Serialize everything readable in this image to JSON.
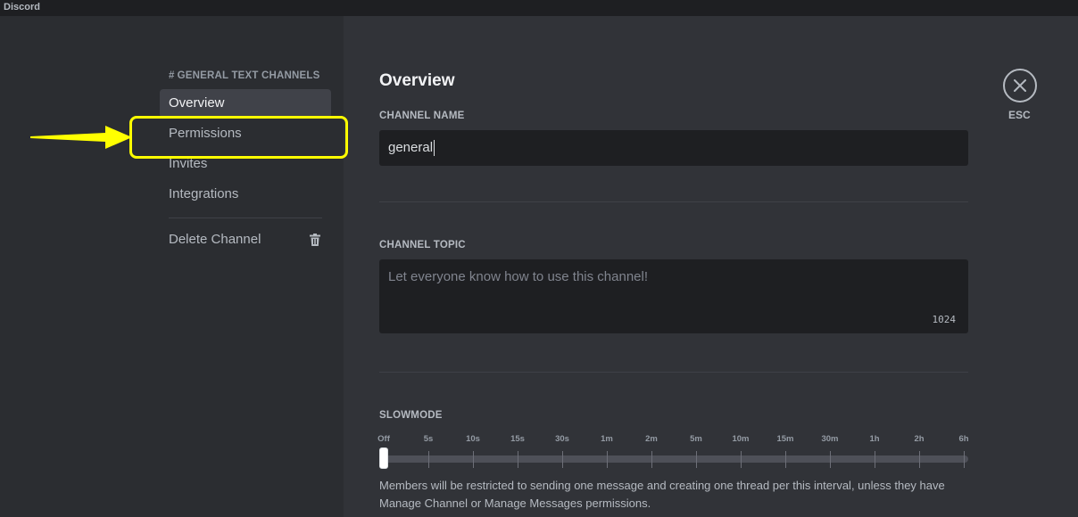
{
  "window": {
    "title": "Discord"
  },
  "sidebar": {
    "header_hash": "#",
    "header_channel": "GENERAL",
    "header_suffix": "TEXT CHANNELS",
    "items": [
      {
        "label": "Overview",
        "selected": true
      },
      {
        "label": "Permissions",
        "selected": false
      },
      {
        "label": "Invites",
        "selected": false
      },
      {
        "label": "Integrations",
        "selected": false
      }
    ],
    "delete_label": "Delete Channel"
  },
  "main": {
    "title": "Overview",
    "channel_name_label": "CHANNEL NAME",
    "channel_name_value": "general",
    "channel_topic_label": "CHANNEL TOPIC",
    "channel_topic_placeholder": "Let everyone know how to use this channel!",
    "channel_topic_counter": "1024",
    "slowmode_label": "SLOWMODE",
    "slowmode_ticks": [
      "Off",
      "5s",
      "10s",
      "15s",
      "30s",
      "1m",
      "2m",
      "5m",
      "10m",
      "15m",
      "30m",
      "1h",
      "2h",
      "6h"
    ],
    "slowmode_value": "Off",
    "slowmode_help": "Members will be restricted to sending one message and creating one thread per this interval, unless they have Manage Channel or Manage Messages permissions."
  },
  "close": {
    "esc_label": "ESC"
  },
  "colors": {
    "highlight": "#ffff00",
    "background": "#313338",
    "sidebar": "#2b2d31"
  }
}
